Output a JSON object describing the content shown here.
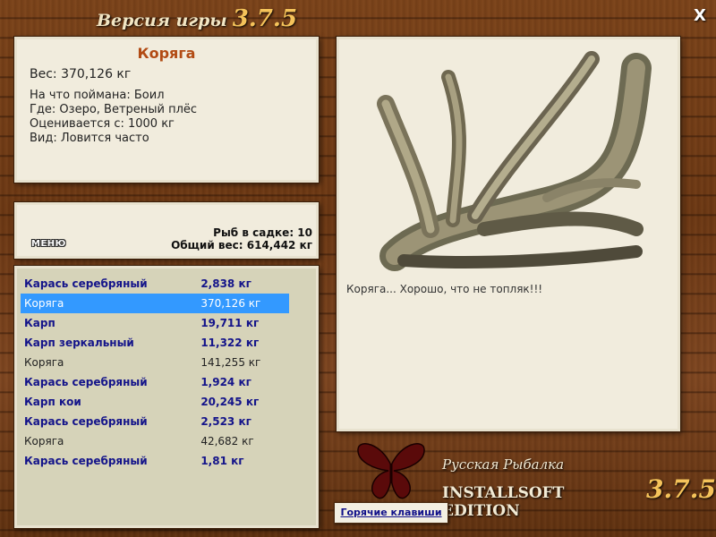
{
  "header": {
    "title": "Версия игры",
    "version": "3.7.5",
    "close_label": "X"
  },
  "info": {
    "name": "Коряга",
    "weight": "Вес: 370,126 кг",
    "lines": [
      "На что поймана: Боил",
      "Где: Озеро, Ветреный плёс",
      "Оценивается с: 1000 кг",
      "Вид: Ловится часто"
    ]
  },
  "stats": {
    "menu_label": "МЕНЮ",
    "fish_count": "Рыб в садке: 10",
    "total_weight": "Общий вес: 614,442 кг"
  },
  "catch_list": [
    {
      "name": "Карась серебряный",
      "weight": "2,838 кг",
      "kind": "fish",
      "selected": false
    },
    {
      "name": "Коряга",
      "weight": "370,126 кг",
      "kind": "junk",
      "selected": true
    },
    {
      "name": "Карп",
      "weight": "19,711 кг",
      "kind": "fish",
      "selected": false
    },
    {
      "name": "Карп зеркальный",
      "weight": "11,322 кг",
      "kind": "fish",
      "selected": false
    },
    {
      "name": "Коряга",
      "weight": "141,255 кг",
      "kind": "junk",
      "selected": false
    },
    {
      "name": "Карась серебряный",
      "weight": "1,924 кг",
      "kind": "fish",
      "selected": false
    },
    {
      "name": "Карп кои",
      "weight": "20,245 кг",
      "kind": "fish",
      "selected": false
    },
    {
      "name": "Карась серебряный",
      "weight": "2,523 кг",
      "kind": "fish",
      "selected": false
    },
    {
      "name": "Коряга",
      "weight": "42,682 кг",
      "kind": "junk",
      "selected": false
    },
    {
      "name": "Карась серебряный",
      "weight": "1,81 кг",
      "kind": "fish",
      "selected": false
    }
  ],
  "picture": {
    "comment": "Коряга... Хорошо, что не топляк!!!",
    "icon": "driftwood-image"
  },
  "brand": {
    "line1": "Русская Рыбалка",
    "line2": "INSTALLSOFT EDITION",
    "version": "3.7.5",
    "logo_icon": "butterfly-icon"
  },
  "hotkeys_label": "Горячие клавиши",
  "colors": {
    "fish_text": "#14148a",
    "junk_text": "#222222",
    "selected_bg": "#3399ff",
    "item_name": "#b24b14",
    "version_accent": "#f5c35a",
    "butterfly": "#5a0a0a"
  }
}
